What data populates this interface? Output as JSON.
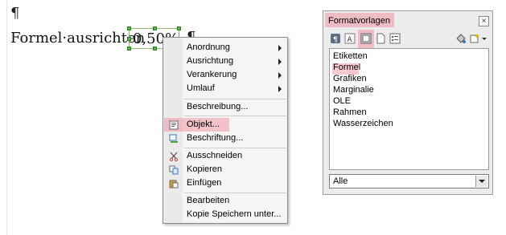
{
  "document": {
    "pilcrow": "¶",
    "text_line": "Formel·ausrichten",
    "formula_value": "0,50%"
  },
  "context_menu": {
    "items": [
      {
        "label": "Anordnung",
        "submenu": true
      },
      {
        "label": "Ausrichtung",
        "submenu": true
      },
      {
        "label": "Verankerung",
        "submenu": true
      },
      {
        "label": "Umlauf",
        "submenu": true
      },
      {
        "label": "Beschreibung..."
      },
      {
        "label": "Objekt...",
        "icon": "object-icon",
        "highlighted": true
      },
      {
        "label": "Beschriftung...",
        "icon": "caption-icon"
      },
      {
        "label": "Ausschneiden",
        "icon": "cut-icon"
      },
      {
        "label": "Kopieren",
        "icon": "copy-icon"
      },
      {
        "label": "Einfügen",
        "icon": "paste-icon"
      },
      {
        "label": "Bearbeiten"
      },
      {
        "label": "Kopie Speichern unter..."
      }
    ]
  },
  "styles_panel": {
    "title": "Formatvorlagen",
    "toolbar_icons": [
      "paragraph-styles-icon",
      "character-styles-icon",
      "frame-styles-icon",
      "page-styles-icon",
      "list-styles-icon",
      "fill-format-icon",
      "new-style-icon"
    ],
    "list": [
      "Etiketten",
      "Formel",
      "Grafiken",
      "Marginalie",
      "OLE",
      "Rahmen",
      "Wasserzeichen"
    ],
    "selected_item": "Formel",
    "filter_value": "Alle"
  },
  "colors": {
    "highlight": "#f0829a",
    "selection_handle": "#59b54b"
  }
}
